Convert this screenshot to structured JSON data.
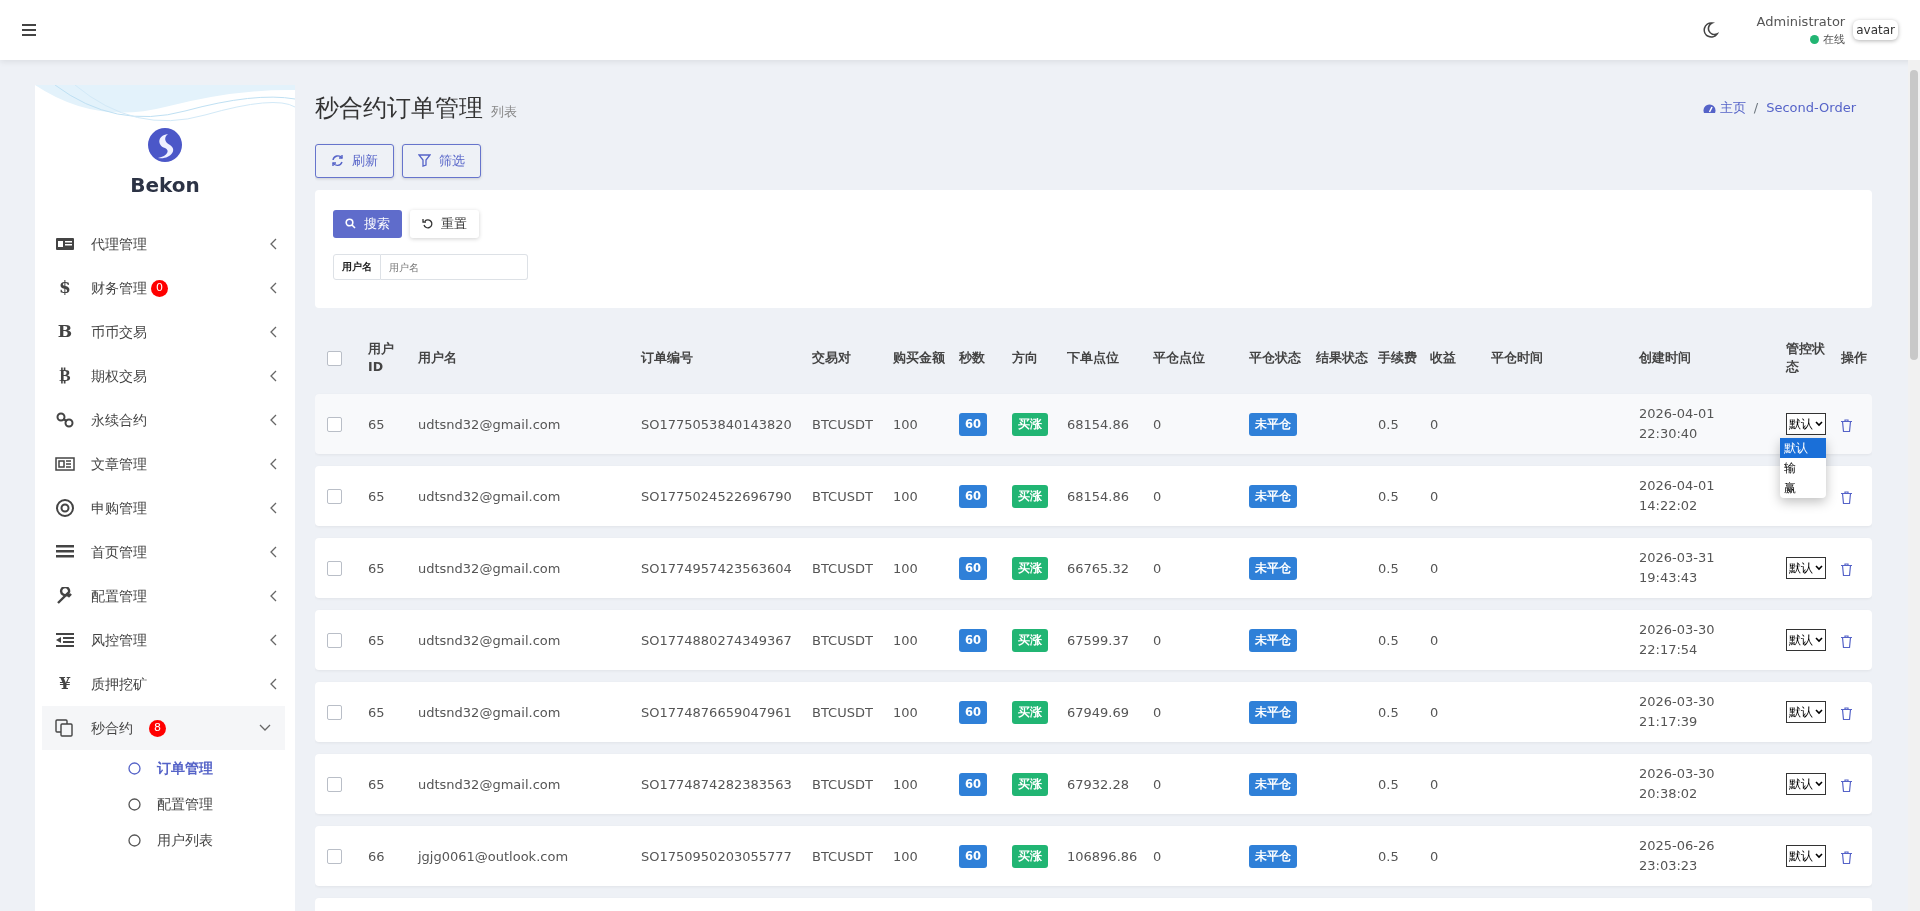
{
  "header": {
    "user_name": "Administrator",
    "status": "在线",
    "online": true,
    "avatar_alt": "avatar"
  },
  "sidebar": {
    "brand": "Bekon",
    "items": [
      {
        "label": "代理管理",
        "kind": "card",
        "expanded": false,
        "selected": false
      },
      {
        "label": "财务管理",
        "glyph": "$",
        "badge": "0",
        "expanded": false,
        "selected": false
      },
      {
        "label": "币币交易",
        "glyph": "B",
        "expanded": false,
        "selected": false
      },
      {
        "label": "期权交易",
        "glyph": "₿",
        "expanded": false,
        "selected": false
      },
      {
        "label": "永续合约",
        "kind": "link",
        "expanded": false,
        "selected": false
      },
      {
        "label": "文章管理",
        "kind": "newspaper",
        "expanded": false,
        "selected": false
      },
      {
        "label": "申购管理",
        "kind": "lifebuoy",
        "expanded": false,
        "selected": false
      },
      {
        "label": "首页管理",
        "kind": "bars",
        "expanded": false,
        "selected": false
      },
      {
        "label": "配置管理",
        "kind": "wrench",
        "expanded": false,
        "selected": false
      },
      {
        "label": "风控管理",
        "kind": "indent",
        "expanded": false,
        "selected": false
      },
      {
        "label": "质押挖矿",
        "glyph": "¥",
        "expanded": false,
        "selected": false
      },
      {
        "label": "秒合约",
        "kind": "copy",
        "badge": "8",
        "expanded": true,
        "selected": true,
        "children": [
          {
            "label": "订单管理",
            "selected": true
          },
          {
            "label": "配置管理",
            "selected": false
          },
          {
            "label": "用户列表",
            "selected": false
          }
        ]
      }
    ]
  },
  "page": {
    "title": "秒合约订单管理",
    "subtitle": "列表",
    "breadcrumb": [
      {
        "label": "主页",
        "kind": "home"
      },
      {
        "label": "Second-Order"
      }
    ],
    "breadcrumb_separator": "/"
  },
  "toolbar": [
    {
      "label": "刷新",
      "kind": "refresh"
    },
    {
      "label": "筛选",
      "kind": "filter"
    }
  ],
  "search": {
    "buttons": [
      {
        "label": "搜索",
        "kind": "search"
      },
      {
        "label": "重置",
        "kind": "reset"
      }
    ],
    "field": {
      "label": "用户名",
      "placeholder": "用户名"
    }
  },
  "table": {
    "select_all": false,
    "columns": [
      "用户ID",
      "用户名",
      "订单编号",
      "交易对",
      "购买金额",
      "秒数",
      "方向",
      "下单点位",
      "平仓点位",
      "平仓状态",
      "结果状态",
      "手续费",
      "收益",
      "平仓时间",
      "创建时间",
      "管控状态",
      "操作"
    ],
    "rows": [
      {
        "checked": false,
        "user_id": "65",
        "username": "udtsnd32@gmail.com",
        "order_no": "SO1775053840143820",
        "pair": "BTCUSDT",
        "amount": "100",
        "seconds": "60",
        "direction": "买涨",
        "open_price": "68154.86",
        "close_price": "0",
        "close_status": "未平仓",
        "fee": "0.5",
        "profit": "0",
        "created": "2026-04-01 22:30:40",
        "control": "默认",
        "control_menu": [
          {
            "label": "默认",
            "selected": true
          },
          {
            "label": "输",
            "selected": false
          },
          {
            "label": "赢",
            "selected": false
          }
        ]
      },
      {
        "checked": false,
        "user_id": "65",
        "username": "udtsnd32@gmail.com",
        "order_no": "SO1775024522696790",
        "pair": "BTCUSDT",
        "amount": "100",
        "seconds": "60",
        "direction": "买涨",
        "open_price": "68154.86",
        "close_price": "0",
        "close_status": "未平仓",
        "fee": "0.5",
        "profit": "0",
        "created": "2026-04-01 14:22:02"
      },
      {
        "checked": false,
        "user_id": "65",
        "username": "udtsnd32@gmail.com",
        "order_no": "SO1774957423563604",
        "pair": "BTCUSDT",
        "amount": "100",
        "seconds": "60",
        "direction": "买涨",
        "open_price": "66765.32",
        "close_price": "0",
        "close_status": "未平仓",
        "fee": "0.5",
        "profit": "0",
        "created": "2026-03-31 19:43:43",
        "control": "默认"
      },
      {
        "checked": false,
        "user_id": "65",
        "username": "udtsnd32@gmail.com",
        "order_no": "SO1774880274349367",
        "pair": "BTCUSDT",
        "amount": "100",
        "seconds": "60",
        "direction": "买涨",
        "open_price": "67599.37",
        "close_price": "0",
        "close_status": "未平仓",
        "fee": "0.5",
        "profit": "0",
        "created": "2026-03-30 22:17:54",
        "control": "默认"
      },
      {
        "checked": false,
        "user_id": "65",
        "username": "udtsnd32@gmail.com",
        "order_no": "SO1774876659047961",
        "pair": "BTCUSDT",
        "amount": "100",
        "seconds": "60",
        "direction": "买涨",
        "open_price": "67949.69",
        "close_price": "0",
        "close_status": "未平仓",
        "fee": "0.5",
        "profit": "0",
        "created": "2026-03-30 21:17:39",
        "control": "默认"
      },
      {
        "checked": false,
        "user_id": "65",
        "username": "udtsnd32@gmail.com",
        "order_no": "SO1774874282383563",
        "pair": "BTCUSDT",
        "amount": "100",
        "seconds": "60",
        "direction": "买涨",
        "open_price": "67932.28",
        "close_price": "0",
        "close_status": "未平仓",
        "fee": "0.5",
        "profit": "0",
        "created": "2026-03-30 20:38:02",
        "control": "默认"
      },
      {
        "checked": false,
        "user_id": "66",
        "username": "jgjg0061@outlook.com",
        "order_no": "SO1750950203055777",
        "pair": "BTCUSDT",
        "amount": "100",
        "seconds": "60",
        "direction": "买涨",
        "open_price": "106896.86",
        "close_price": "0",
        "close_status": "未平仓",
        "fee": "0.5",
        "profit": "0",
        "created": "2025-06-26 23:03:23",
        "control": "默认"
      }
    ]
  }
}
